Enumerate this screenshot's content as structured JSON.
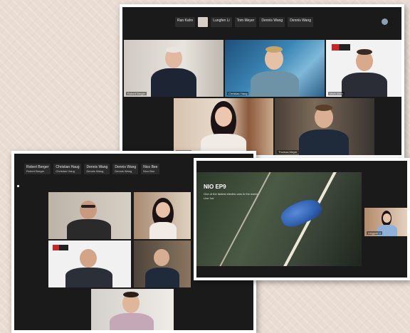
{
  "top_shot": {
    "strip": [
      "Ran Kahn",
      "Lungfen Li",
      "Tom Meyer",
      "Dennis Wang",
      "Dennis Wang"
    ],
    "badge": "",
    "tiles": [
      {
        "name": "Robert Berger"
      },
      {
        "name": "Christian Haug"
      },
      {
        "name": "Mark Allen"
      },
      {
        "name": "Lingyun Li"
      },
      {
        "name": "Thomas Meyer"
      }
    ]
  },
  "left_shot": {
    "strip": [
      "Robert Berger",
      "Christian Haug",
      "Dennis Wang",
      "Dennis Wang",
      "Nico Bee"
    ],
    "strip_sub": [
      "Robert Berger",
      "Christian Haug",
      "Dennis Wang",
      "Dennis Wang",
      "Nico Bee"
    ]
  },
  "presentation": {
    "brand": "NIO EP9",
    "tagline_1": "One of the fastest electric cars in the world",
    "tagline_2": "Live 1st.",
    "presenter": "Lingyun Li"
  },
  "colors": {
    "frame": "#ffffff",
    "zoom_bg": "#1a1a1a",
    "car_blue": "#2f5fb0",
    "brand_red": "#c62828"
  },
  "icons": [
    "more-icon"
  ]
}
